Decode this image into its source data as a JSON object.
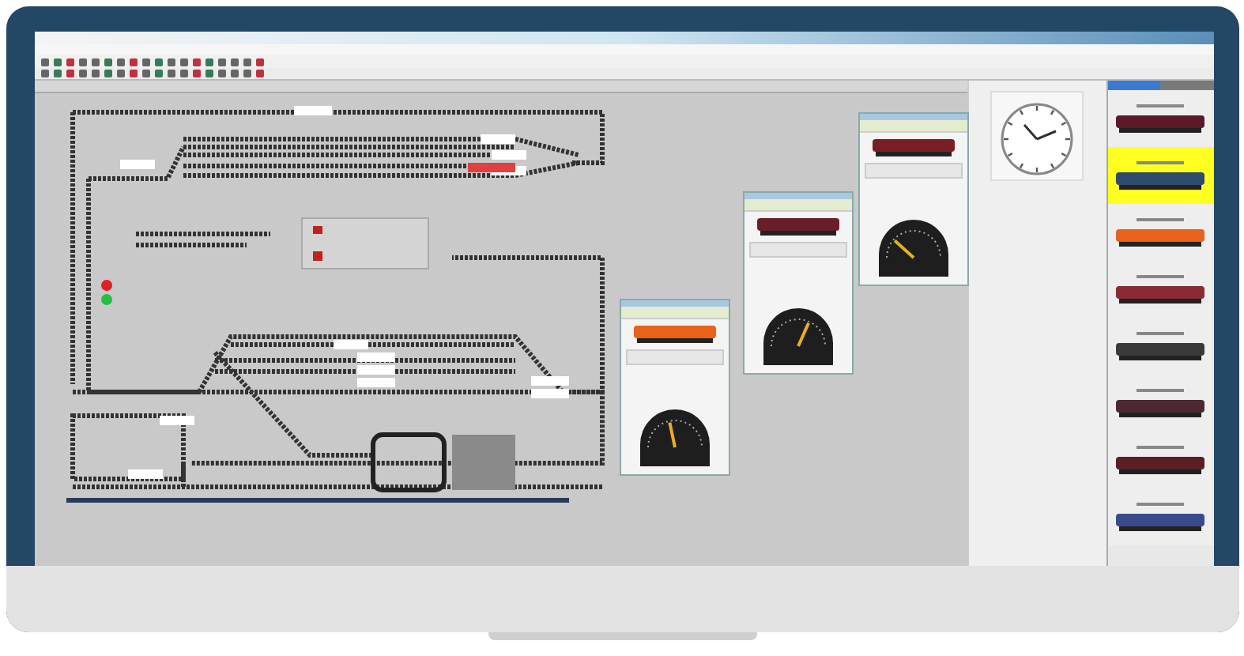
{
  "throttles": [
    {
      "color": "#e8621c",
      "level": 0.45
    },
    {
      "color": "#6b1e2a",
      "level": 0.6
    },
    {
      "color": "#7a1e26",
      "level": 0.3
    }
  ],
  "signals": [
    {
      "color": "#e02020"
    },
    {
      "color": "#20c040"
    }
  ],
  "locomotive_list": {
    "tabs": [
      {
        "selected": true
      },
      {
        "selected": false
      }
    ],
    "items": [
      {
        "color": "#5a1a2a",
        "selected": false
      },
      {
        "color": "#2f4a6e",
        "selected": true
      },
      {
        "color": "#e8621c",
        "selected": false
      },
      {
        "color": "#8a2a35",
        "selected": false
      },
      {
        "color": "#3a3a3a",
        "selected": false
      },
      {
        "color": "#4a2a30",
        "selected": false
      },
      {
        "color": "#5a1e26",
        "selected": false
      },
      {
        "color": "#3a4a8a",
        "selected": false
      }
    ]
  }
}
